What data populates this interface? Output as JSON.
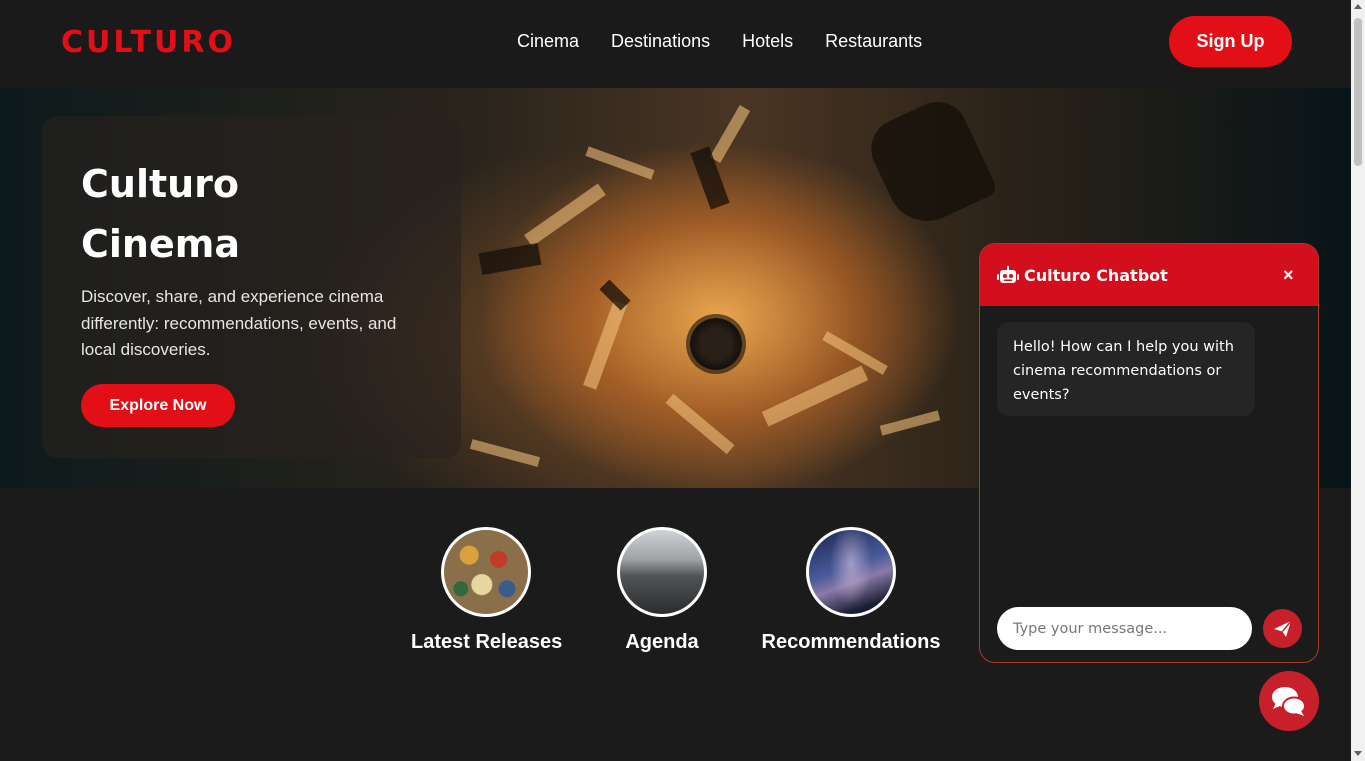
{
  "header": {
    "logo": "CULTURO",
    "nav": [
      "Cinema",
      "Destinations",
      "Hotels",
      "Restaurants"
    ],
    "signup_label": "Sign Up"
  },
  "hero": {
    "title_line1": "Culturo",
    "title_line2": "Cinema",
    "description": "Discover, share, and experience cinema differently: recommendations, events, and local discoveries.",
    "cta_label": "Explore Now"
  },
  "features": [
    {
      "label": "Latest Releases",
      "icon": "stickers-image"
    },
    {
      "label": "Agenda",
      "icon": "office-image"
    },
    {
      "label": "Recommendations",
      "icon": "milky-way-image"
    }
  ],
  "chatbot": {
    "title": "Culturo Chatbot",
    "close_label": "×",
    "welcome_message": "Hello! How can I help you with cinema recommendations or events?",
    "input_placeholder": "Type your message...",
    "send_icon": "paper-plane-icon",
    "bot_icon": "robot-icon"
  },
  "colors": {
    "brand_red": "#e30f17",
    "chat_header": "#d30f1e",
    "background": "#1c1b1b"
  }
}
